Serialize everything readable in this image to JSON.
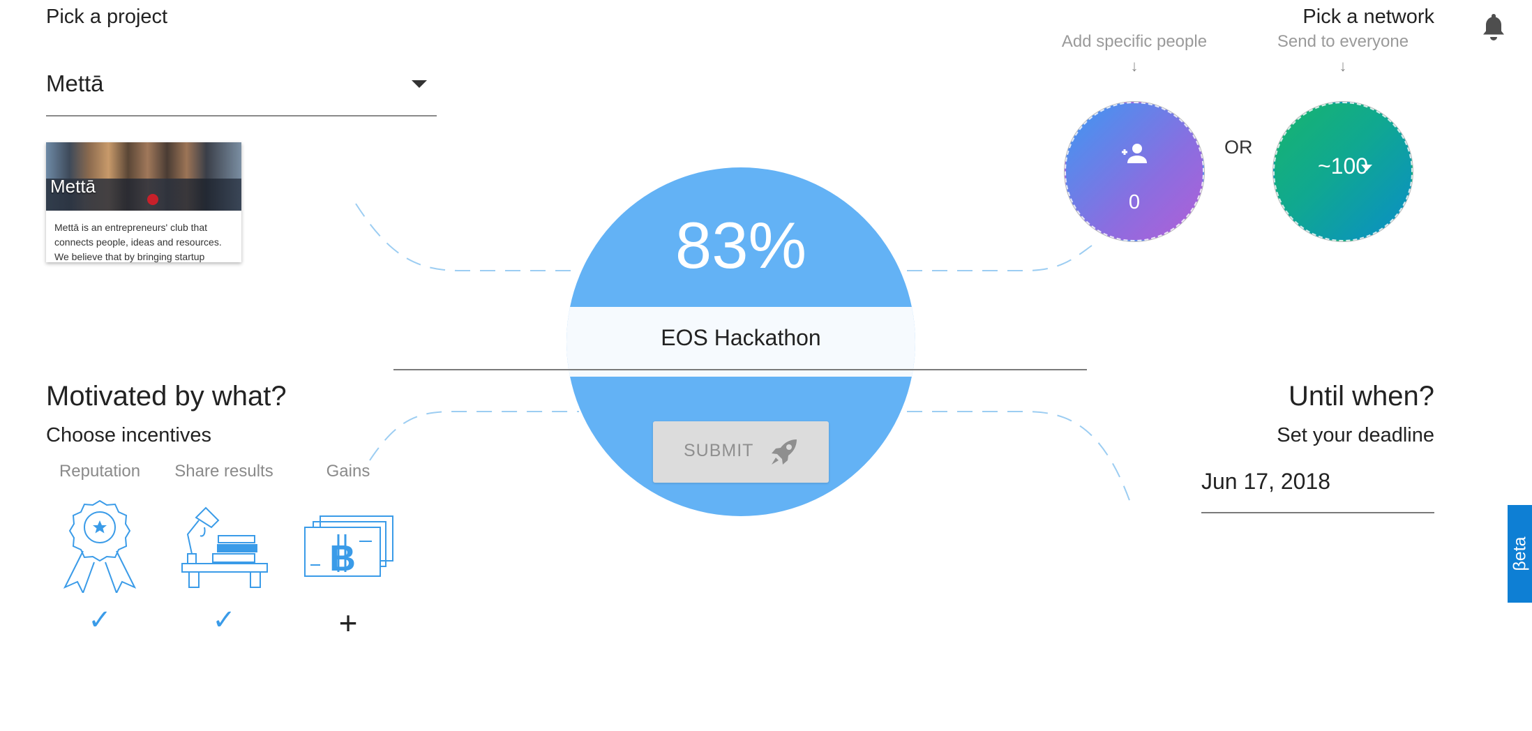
{
  "project": {
    "label": "Pick a project",
    "selected": "Mettā",
    "card": {
      "logo": "Mettā",
      "description": "Mettā is an entrepreneurs' club that connects people, ideas and resources. We believe that by bringing startup"
    }
  },
  "network": {
    "label": "Pick a network",
    "specific_hint": "Add specific people",
    "everyone_hint": "Send to everyone",
    "down_arrow": "↓",
    "people_count": "0",
    "or_label": "OR",
    "everyone_count": "~100"
  },
  "center": {
    "percent": "83%",
    "hackathon_name": "EOS Hackathon",
    "submit_label": "SUBMIT"
  },
  "incentives": {
    "title": "Motivated by what?",
    "subtitle": "Choose incentives",
    "items": [
      {
        "label": "Reputation",
        "icon": "ribbon-badge-icon",
        "state": "✓"
      },
      {
        "label": "Share results",
        "icon": "desk-lamp-books-icon",
        "state": "✓"
      },
      {
        "label": "Gains",
        "icon": "bitcoin-bills-icon",
        "state": "+"
      }
    ]
  },
  "deadline": {
    "title": "Until when?",
    "subtitle": "Set your deadline",
    "value": "Jun 17, 2018"
  },
  "beta_tab": "βeta",
  "colors": {
    "accent_blue": "#63b2f5",
    "people_gradient": [
      "#3d98f2",
      "#b25ed6"
    ],
    "everyone_gradient": [
      "#18b46e",
      "#0a8ec8"
    ],
    "check_blue": "#3a9be8",
    "beta_blue": "#0e7fd4"
  }
}
